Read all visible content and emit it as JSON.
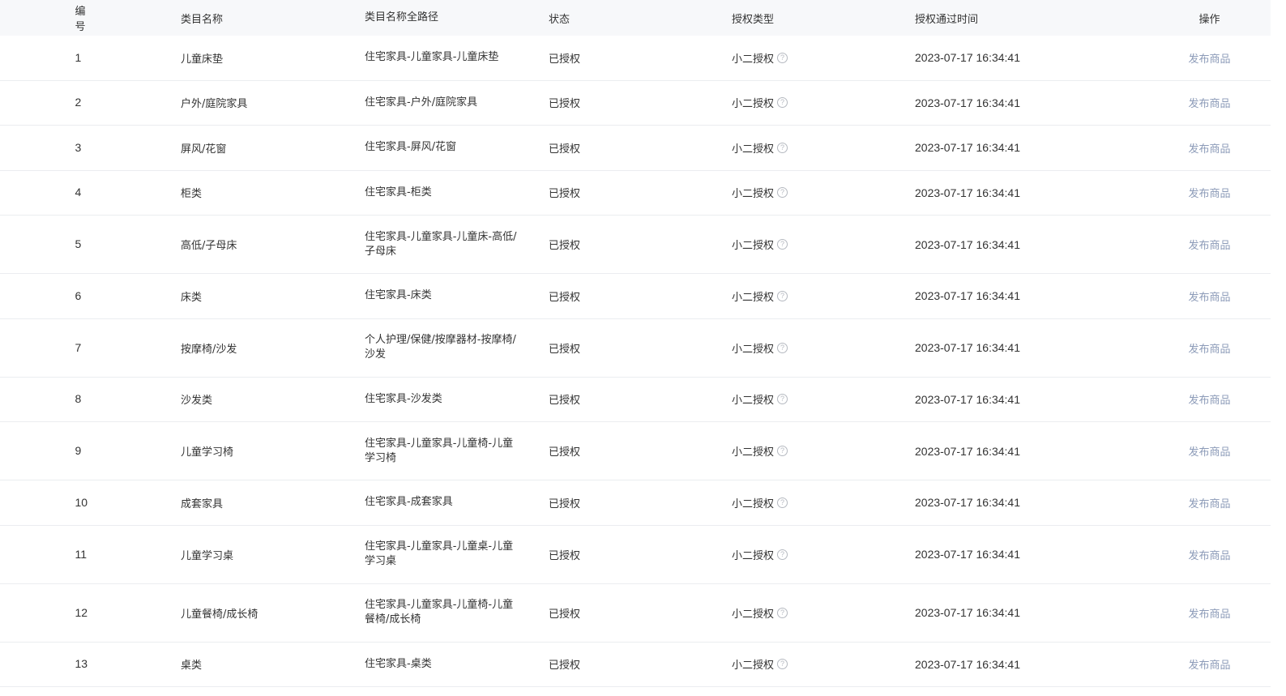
{
  "table": {
    "headers": {
      "id": "编号",
      "name": "类目名称",
      "path": "类目名称全路径",
      "status": "状态",
      "auth_type": "授权类型",
      "auth_time": "授权通过时间",
      "op": "操作"
    },
    "rows": [
      {
        "id": "1",
        "name": "儿童床垫",
        "path": "住宅家具-儿童家具-儿童床垫",
        "status": "已授权",
        "auth_type": "小二授权",
        "auth_time": "2023-07-17 16:34:41",
        "op": "发布商品"
      },
      {
        "id": "2",
        "name": "户外/庭院家具",
        "path": "住宅家具-户外/庭院家具",
        "status": "已授权",
        "auth_type": "小二授权",
        "auth_time": "2023-07-17 16:34:41",
        "op": "发布商品"
      },
      {
        "id": "3",
        "name": "屏风/花窗",
        "path": "住宅家具-屏风/花窗",
        "status": "已授权",
        "auth_type": "小二授权",
        "auth_time": "2023-07-17 16:34:41",
        "op": "发布商品"
      },
      {
        "id": "4",
        "name": "柜类",
        "path": "住宅家具-柜类",
        "status": "已授权",
        "auth_type": "小二授权",
        "auth_time": "2023-07-17 16:34:41",
        "op": "发布商品"
      },
      {
        "id": "5",
        "name": "高低/子母床",
        "path": "住宅家具-儿童家具-儿童床-高低/子母床",
        "status": "已授权",
        "auth_type": "小二授权",
        "auth_time": "2023-07-17 16:34:41",
        "op": "发布商品"
      },
      {
        "id": "6",
        "name": "床类",
        "path": "住宅家具-床类",
        "status": "已授权",
        "auth_type": "小二授权",
        "auth_time": "2023-07-17 16:34:41",
        "op": "发布商品"
      },
      {
        "id": "7",
        "name": "按摩椅/沙发",
        "path": "个人护理/保健/按摩器材-按摩椅/沙发",
        "status": "已授权",
        "auth_type": "小二授权",
        "auth_time": "2023-07-17 16:34:41",
        "op": "发布商品"
      },
      {
        "id": "8",
        "name": "沙发类",
        "path": "住宅家具-沙发类",
        "status": "已授权",
        "auth_type": "小二授权",
        "auth_time": "2023-07-17 16:34:41",
        "op": "发布商品"
      },
      {
        "id": "9",
        "name": "儿童学习椅",
        "path": "住宅家具-儿童家具-儿童椅-儿童学习椅",
        "status": "已授权",
        "auth_type": "小二授权",
        "auth_time": "2023-07-17 16:34:41",
        "op": "发布商品"
      },
      {
        "id": "10",
        "name": "成套家具",
        "path": "住宅家具-成套家具",
        "status": "已授权",
        "auth_type": "小二授权",
        "auth_time": "2023-07-17 16:34:41",
        "op": "发布商品"
      },
      {
        "id": "11",
        "name": "儿童学习桌",
        "path": "住宅家具-儿童家具-儿童桌-儿童学习桌",
        "status": "已授权",
        "auth_type": "小二授权",
        "auth_time": "2023-07-17 16:34:41",
        "op": "发布商品"
      },
      {
        "id": "12",
        "name": "儿童餐椅/成长椅",
        "path": "住宅家具-儿童家具-儿童椅-儿童餐椅/成长椅",
        "status": "已授权",
        "auth_type": "小二授权",
        "auth_time": "2023-07-17 16:34:41",
        "op": "发布商品"
      },
      {
        "id": "13",
        "name": "桌类",
        "path": "住宅家具-桌类",
        "status": "已授权",
        "auth_type": "小二授权",
        "auth_time": "2023-07-17 16:34:41",
        "op": "发布商品"
      }
    ]
  },
  "icons": {
    "help": "question-circle-icon"
  },
  "colors": {
    "header_bg": "#f7f8fa",
    "link": "#8c9bb8",
    "border": "#ebedf0"
  }
}
